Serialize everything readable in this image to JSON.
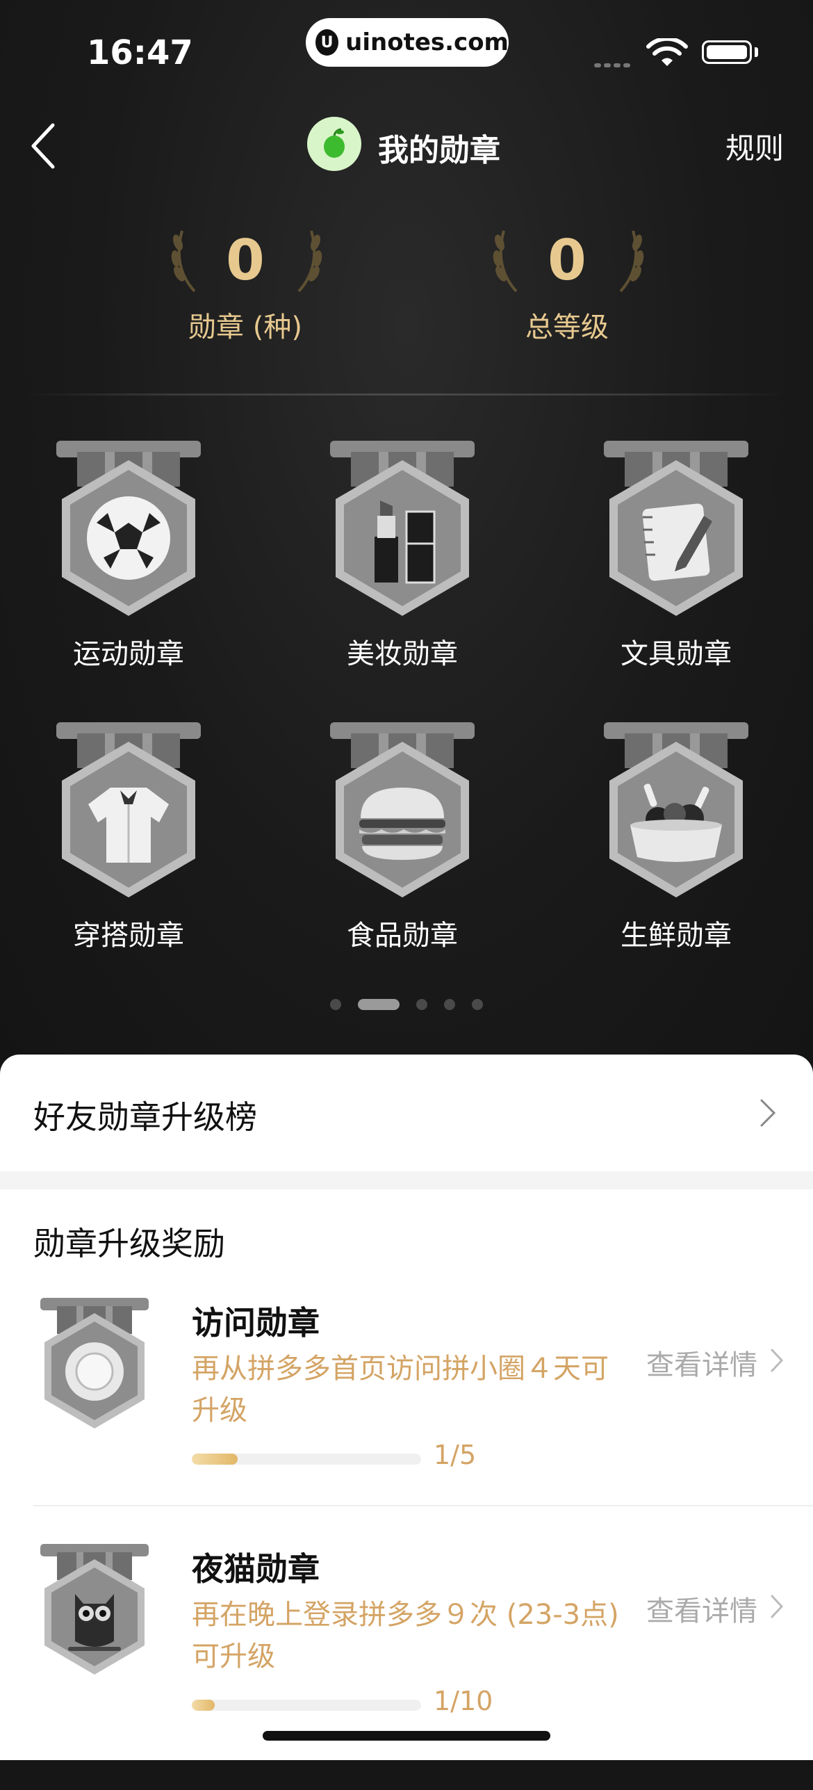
{
  "status": {
    "time": "16:47",
    "site": "uinotes.com"
  },
  "nav": {
    "title": "我的勋章",
    "rules": "规则"
  },
  "stats": [
    {
      "value": "0",
      "label": "勋章 (种)"
    },
    {
      "value": "0",
      "label": "总等级"
    }
  ],
  "badges": [
    {
      "label": "运动勋章",
      "icon": "soccer-ball-icon"
    },
    {
      "label": "美妆勋章",
      "icon": "cosmetics-icon"
    },
    {
      "label": "文具勋章",
      "icon": "notebook-pen-icon"
    },
    {
      "label": "穿搭勋章",
      "icon": "shirt-icon"
    },
    {
      "label": "食品勋章",
      "icon": "burger-icon"
    },
    {
      "label": "生鲜勋章",
      "icon": "fresh-basket-icon"
    }
  ],
  "pager": {
    "count": 5,
    "active": 1
  },
  "friend_rank": {
    "title": "好友勋章升级榜"
  },
  "rewards": {
    "title": "勋章升级奖励",
    "items": [
      {
        "name": "访问勋章",
        "desc": "再从拼多多首页访问拼小圈４天可升级",
        "progress_text": "1/5",
        "progress": 0.2,
        "detail": "查看详情",
        "icon": "sun-badge-icon"
      },
      {
        "name": "夜猫勋章",
        "desc": "再在晚上登录拼多多９次 (23-3点) 可升级",
        "progress_text": "1/10",
        "progress": 0.1,
        "detail": "查看详情",
        "icon": "owl-badge-icon"
      }
    ]
  },
  "colors": {
    "gold": "#e7c98f",
    "accent_text": "#d4a465",
    "dark_bg": "#161616"
  }
}
